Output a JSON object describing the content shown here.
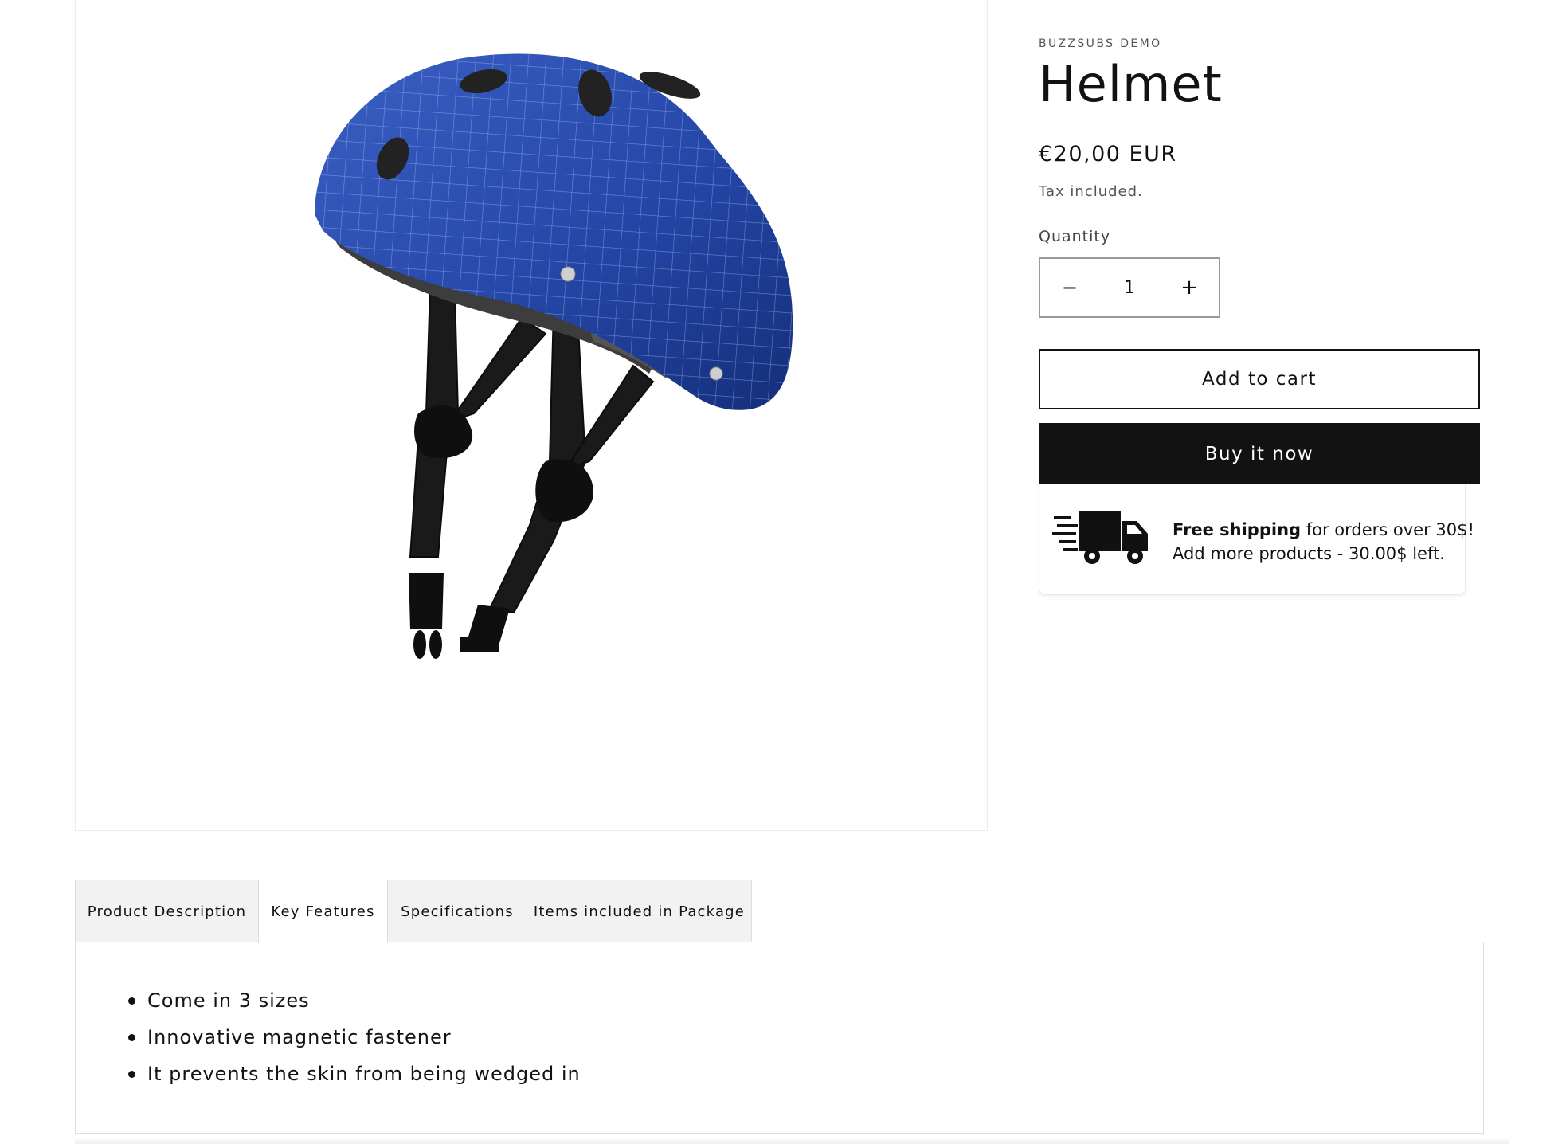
{
  "product": {
    "vendor": "BUZZSUBS DEMO",
    "title": "Helmet",
    "price": "€20,00 EUR",
    "tax_note": "Tax included.",
    "quantity_label": "Quantity",
    "quantity_value": "1",
    "decrease_symbol": "−",
    "increase_symbol": "+",
    "add_to_cart_label": "Add to cart",
    "buy_now_label": "Buy it now"
  },
  "shipping": {
    "bold": "Free shipping",
    "rest": " for orders over 30$!",
    "line2": "Add more products - 30.00$ left."
  },
  "tabs": [
    {
      "label": "Product Description",
      "active": false
    },
    {
      "label": "Key Features",
      "active": true
    },
    {
      "label": "Specifications",
      "active": false
    },
    {
      "label": "Items included in Package",
      "active": false
    }
  ],
  "key_features": [
    "Come in 3 sizes",
    "Innovative magnetic fastener",
    "It prevents the skin from being wedged in"
  ],
  "colors": {
    "helmet_blue": "#1c3f9a",
    "button_dark": "#121212"
  }
}
